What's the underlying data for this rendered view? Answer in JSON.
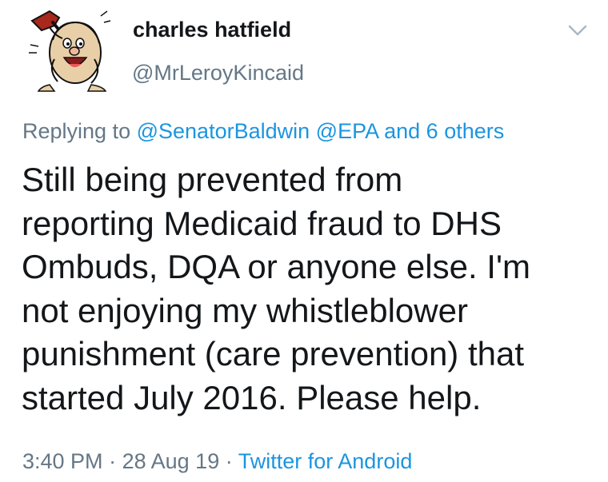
{
  "author": {
    "display_name": "charles hatfield",
    "handle": "@MrLeroyKincaid",
    "avatar_icon": "caveman-cartoon-avatar"
  },
  "more_menu_icon": "chevron-down-icon",
  "reply_context": {
    "prefix": "Replying to",
    "mentions": [
      "@SenatorBaldwin",
      "@EPA"
    ],
    "and_others": "and 6 others"
  },
  "tweet_text": "Still being prevented from\nreporting Medicaid fraud to DHS\nOmbuds, DQA or anyone else.  I'm\nnot enjoying my whistleblower\npunishment (care prevention) that\nstarted July 2016.  Please help.",
  "meta": {
    "time": "3:40 PM",
    "separator": "·",
    "date": "28 Aug 19",
    "source": "Twitter for Android"
  },
  "colors": {
    "text": "#14171a",
    "secondary": "#657786",
    "link": "#1b95e0"
  }
}
